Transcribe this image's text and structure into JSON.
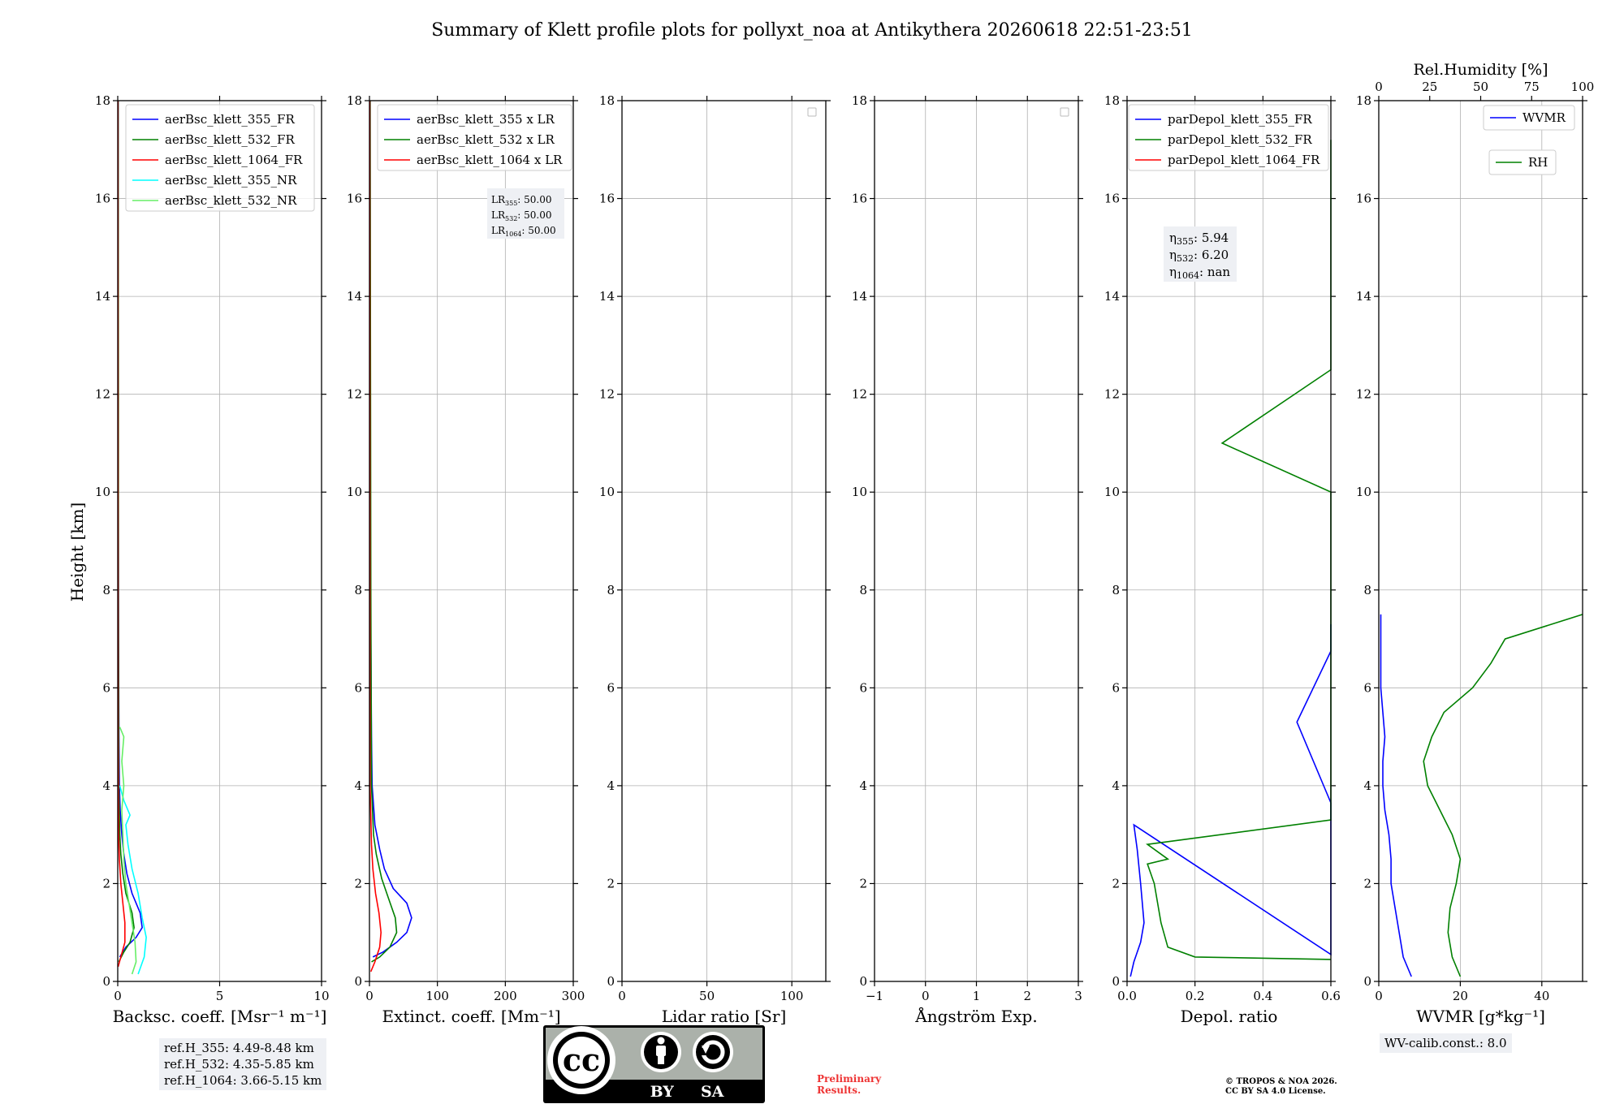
{
  "title": "Summary of Klett profile plots for pollyxt_noa at Antikythera 20260618 22:51-23:51",
  "height_label": "Height [km]",
  "colors": {
    "b355": "#0000ff",
    "g532": "#008000",
    "r1064": "#ff0000",
    "c355nr": "#00ffff",
    "lg532nr": "#66ee66"
  },
  "chart_data": [
    {
      "id": "backscatter",
      "type": "line",
      "xlabel": "Backsc. coeff. [Msr⁻¹ m⁻¹]",
      "xlim": [
        0,
        10
      ],
      "ylim": [
        0,
        18
      ],
      "xticks": [
        "0",
        "5",
        "10"
      ],
      "yticks": [
        "0",
        "2",
        "4",
        "6",
        "8",
        "10",
        "12",
        "14",
        "16",
        "18"
      ],
      "grid": true,
      "legend_position": "top-right",
      "series": [
        {
          "name": "aerBsc_klett_355_FR",
          "color": "#0000ff",
          "points": [
            [
              0.1,
              0.5
            ],
            [
              0.4,
              0.7
            ],
            [
              0.9,
              0.9
            ],
            [
              1.2,
              1.1
            ],
            [
              1.1,
              1.4
            ],
            [
              0.7,
              1.8
            ],
            [
              0.45,
              2.2
            ],
            [
              0.3,
              2.6
            ],
            [
              0.2,
              3.0
            ],
            [
              0.12,
              3.5
            ],
            [
              0.08,
              4.0
            ],
            [
              0.06,
              5.0
            ],
            [
              0.04,
              7.0
            ],
            [
              0.03,
              9.0
            ],
            [
              0.02,
              12.0
            ],
            [
              0.02,
              18.0
            ]
          ]
        },
        {
          "name": "aerBsc_klett_532_FR",
          "color": "#008000",
          "points": [
            [
              0.05,
              0.4
            ],
            [
              0.3,
              0.6
            ],
            [
              0.6,
              0.8
            ],
            [
              0.8,
              1.1
            ],
            [
              0.7,
              1.4
            ],
            [
              0.4,
              1.8
            ],
            [
              0.25,
              2.2
            ],
            [
              0.15,
              2.6
            ],
            [
              0.1,
              3.0
            ],
            [
              0.05,
              4.0
            ],
            [
              0.03,
              8.0
            ],
            [
              0.03,
              12.0
            ],
            [
              0.02,
              18.0
            ]
          ]
        },
        {
          "name": "aerBsc_klett_1064_FR",
          "color": "#ff0000",
          "points": [
            [
              0.02,
              0.3
            ],
            [
              0.15,
              0.5
            ],
            [
              0.35,
              0.8
            ],
            [
              0.35,
              1.2
            ],
            [
              0.25,
              1.6
            ],
            [
              0.15,
              2.0
            ],
            [
              0.08,
              2.5
            ],
            [
              0.04,
              3.0
            ],
            [
              0.02,
              5.0
            ],
            [
              0.01,
              18.0
            ]
          ]
        },
        {
          "name": "aerBsc_klett_355_NR",
          "color": "#00ffff",
          "points": [
            [
              1.0,
              0.15
            ],
            [
              1.3,
              0.5
            ],
            [
              1.4,
              0.9
            ],
            [
              1.2,
              1.3
            ],
            [
              1.0,
              1.8
            ],
            [
              0.7,
              2.3
            ],
            [
              0.5,
              2.8
            ],
            [
              0.4,
              3.2
            ],
            [
              0.6,
              3.4
            ],
            [
              0.3,
              3.7
            ],
            [
              0.1,
              4.0
            ]
          ]
        },
        {
          "name": "aerBsc_klett_532_NR",
          "color": "#66ee66",
          "points": [
            [
              0.7,
              0.15
            ],
            [
              0.9,
              0.4
            ],
            [
              0.85,
              0.8
            ],
            [
              0.7,
              1.2
            ],
            [
              0.55,
              1.6
            ],
            [
              0.4,
              2.0
            ],
            [
              0.3,
              2.5
            ],
            [
              0.25,
              3.0
            ],
            [
              0.2,
              3.5
            ],
            [
              0.3,
              4.0
            ],
            [
              0.2,
              4.5
            ],
            [
              0.3,
              5.0
            ],
            [
              0.1,
              5.2
            ]
          ]
        }
      ],
      "note_lines": [
        "ref.H_355: 4.49-8.48 km",
        "ref.H_532: 4.35-5.85 km",
        "ref.H_1064: 3.66-5.15 km"
      ]
    },
    {
      "id": "extinction",
      "type": "line",
      "xlabel": "Extinct. coeff. [Mm⁻¹]",
      "xlim": [
        0,
        300
      ],
      "ylim": [
        0,
        18
      ],
      "xticks": [
        "0",
        "100",
        "200",
        "300"
      ],
      "yticks": [
        "0",
        "2",
        "4",
        "6",
        "8",
        "10",
        "12",
        "14",
        "16",
        "18"
      ],
      "grid": true,
      "legend_position": "top-right",
      "series": [
        {
          "name": "aerBsc_klett_355 x LR",
          "color": "#0000ff",
          "points": [
            [
              5,
              0.5
            ],
            [
              20,
              0.6
            ],
            [
              40,
              0.8
            ],
            [
              55,
              1.0
            ],
            [
              62,
              1.3
            ],
            [
              55,
              1.6
            ],
            [
              35,
              1.9
            ],
            [
              22,
              2.3
            ],
            [
              15,
              2.7
            ],
            [
              8,
              3.2
            ],
            [
              4,
              4.0
            ],
            [
              3,
              5.0
            ],
            [
              2,
              7.0
            ],
            [
              1,
              10.0
            ],
            [
              1,
              18.0
            ]
          ]
        },
        {
          "name": "aerBsc_klett_532 x LR",
          "color": "#008000",
          "points": [
            [
              3,
              0.4
            ],
            [
              15,
              0.5
            ],
            [
              30,
              0.7
            ],
            [
              40,
              1.0
            ],
            [
              38,
              1.3
            ],
            [
              28,
              1.7
            ],
            [
              18,
              2.1
            ],
            [
              10,
              2.6
            ],
            [
              6,
              3.0
            ],
            [
              3,
              4.0
            ],
            [
              2,
              8.0
            ],
            [
              1,
              18.0
            ]
          ]
        },
        {
          "name": "aerBsc_klett_1064 x LR",
          "color": "#ff0000",
          "points": [
            [
              2,
              0.2
            ],
            [
              8,
              0.4
            ],
            [
              15,
              0.7
            ],
            [
              17,
              1.0
            ],
            [
              14,
              1.4
            ],
            [
              9,
              1.8
            ],
            [
              5,
              2.3
            ],
            [
              3,
              2.8
            ],
            [
              1,
              4.0
            ],
            [
              0.5,
              18.0
            ]
          ]
        }
      ],
      "lr_lines": [
        {
          "sub": "355",
          "value": ": 50.00"
        },
        {
          "sub": "532",
          "value": ": 50.00"
        },
        {
          "sub": "1064",
          "value": ": 50.00"
        }
      ]
    },
    {
      "id": "lidar_ratio",
      "type": "line",
      "xlabel": "Lidar ratio [Sr]",
      "xlim": [
        0,
        120
      ],
      "ylim": [
        0,
        18
      ],
      "xticks": [
        "0",
        "50",
        "100"
      ],
      "yticks": [
        "0",
        "2",
        "4",
        "6",
        "8",
        "10",
        "12",
        "14",
        "16",
        "18"
      ],
      "grid": true,
      "legend_position": "top-right",
      "series": []
    },
    {
      "id": "angstrom",
      "type": "line",
      "xlabel": "Ångström Exp.",
      "xlim": [
        -1,
        3
      ],
      "ylim": [
        0,
        18
      ],
      "xticks": [
        "−1",
        "0",
        "1",
        "2",
        "3"
      ],
      "yticks": [
        "0",
        "2",
        "4",
        "6",
        "8",
        "10",
        "12",
        "14",
        "16",
        "18"
      ],
      "grid": true,
      "legend_position": "top-right",
      "series": []
    },
    {
      "id": "depol",
      "type": "line",
      "xlabel": "Depol. ratio",
      "xlim": [
        0,
        0.6
      ],
      "ylim": [
        0,
        18
      ],
      "xticks": [
        "0.0",
        "0.2",
        "0.4",
        "0.6"
      ],
      "yticks": [
        "0",
        "2",
        "4",
        "6",
        "8",
        "10",
        "12",
        "14",
        "16",
        "18"
      ],
      "grid": true,
      "legend_position": "top-left",
      "series": [
        {
          "name": "parDepol_klett_355_FR",
          "color": "#0000ff",
          "points": [
            [
              0.01,
              0.1
            ],
            [
              0.02,
              0.4
            ],
            [
              0.04,
              0.8
            ],
            [
              0.05,
              1.2
            ],
            [
              0.04,
              2.0
            ],
            [
              0.03,
              2.7
            ],
            [
              0.02,
              3.2
            ],
            [
              0.6,
              0.55
            ],
            [
              0.6,
              3.65
            ],
            [
              0.5,
              5.3
            ],
            [
              0.6,
              6.75
            ],
            [
              0.6,
              7.3
            ]
          ]
        },
        {
          "name": "parDepol_klett_532_FR",
          "color": "#008000",
          "points": [
            [
              0.6,
              0.45
            ],
            [
              0.2,
              0.5
            ],
            [
              0.12,
              0.7
            ],
            [
              0.1,
              1.2
            ],
            [
              0.08,
              2.0
            ],
            [
              0.06,
              2.4
            ],
            [
              0.12,
              2.5
            ],
            [
              0.06,
              2.8
            ],
            [
              0.6,
              3.3
            ],
            [
              0.6,
              3.5
            ],
            [
              0.6,
              4.8
            ],
            [
              0.6,
              7.0
            ],
            [
              0.6,
              8.0
            ],
            [
              0.6,
              9.0
            ],
            [
              0.6,
              10.0
            ],
            [
              0.28,
              11.0
            ],
            [
              0.6,
              12.5
            ],
            [
              0.6,
              14.7
            ],
            [
              0.6,
              15.7
            ],
            [
              0.6,
              16.2
            ],
            [
              0.6,
              17.2
            ]
          ]
        },
        {
          "name": "parDepol_klett_1064_FR",
          "color": "#ff0000",
          "points": []
        }
      ],
      "eta_lines": [
        {
          "sub": "355",
          "value": ": 5.94"
        },
        {
          "sub": "532",
          "value": ": 6.20"
        },
        {
          "sub": "1064",
          "value": ": nan"
        }
      ]
    },
    {
      "id": "wvmr",
      "type": "line",
      "xlabel": "WVMR [g*kg⁻¹]",
      "xlim": [
        0,
        50
      ],
      "ylim": [
        0,
        18
      ],
      "xticks": [
        "0",
        "20",
        "40"
      ],
      "yticks": [
        "0",
        "2",
        "4",
        "6",
        "8",
        "10",
        "12",
        "14",
        "16",
        "18"
      ],
      "top_xlabel": "Rel.Humidity [%]",
      "top_xlim": [
        0,
        100
      ],
      "top_xticks": [
        "0",
        "25",
        "50",
        "75",
        "100"
      ],
      "grid": true,
      "legend_position": "top-right",
      "series": [
        {
          "name": "WVMR",
          "color": "#0000ff",
          "points": [
            [
              8,
              0.1
            ],
            [
              6,
              0.5
            ],
            [
              5,
              1.0
            ],
            [
              4,
              1.5
            ],
            [
              3,
              2.0
            ],
            [
              3,
              2.5
            ],
            [
              2.5,
              3.0
            ],
            [
              1.5,
              3.5
            ],
            [
              1,
              4.0
            ],
            [
              1,
              4.5
            ],
            [
              1.5,
              5.0
            ],
            [
              1,
              5.5
            ],
            [
              0.5,
              6.0
            ],
            [
              0.5,
              6.5
            ],
            [
              0.5,
              7.0
            ],
            [
              0.5,
              7.5
            ]
          ]
        },
        {
          "name": "RH",
          "color": "#008000",
          "axis": "top",
          "points": [
            [
              40,
              0.1
            ],
            [
              36,
              0.5
            ],
            [
              34,
              1.0
            ],
            [
              35,
              1.5
            ],
            [
              38,
              2.0
            ],
            [
              40,
              2.5
            ],
            [
              36,
              3.0
            ],
            [
              30,
              3.5
            ],
            [
              24,
              4.0
            ],
            [
              22,
              4.5
            ],
            [
              26,
              5.0
            ],
            [
              32,
              5.5
            ],
            [
              46,
              6.0
            ],
            [
              55,
              6.5
            ],
            [
              62,
              7.0
            ],
            [
              100,
              7.5
            ]
          ]
        }
      ],
      "note_lines": [
        "WV-calib.const.: 8.0"
      ]
    }
  ],
  "license": {
    "top": "cc",
    "bottom": "BY     SA"
  },
  "preliminary": [
    "Preliminary",
    "Results."
  ],
  "copyright": [
    "© TROPOS & NOA 2026.",
    "CC BY SA 4.0 License."
  ]
}
